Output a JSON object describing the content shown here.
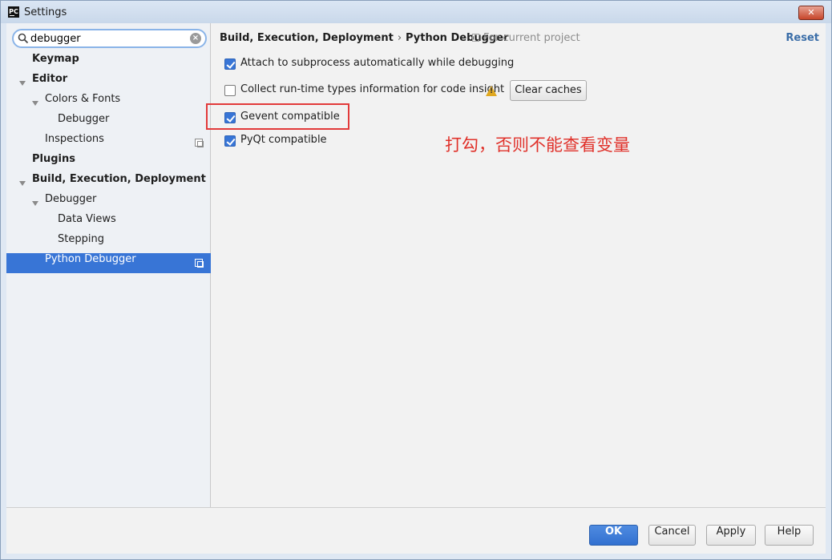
{
  "window": {
    "title": "Settings",
    "app_icon": "PC",
    "close_glyph": "✕"
  },
  "search": {
    "value": "debugger",
    "placeholder": ""
  },
  "tree": [
    {
      "label": "Keymap",
      "bold": true,
      "level": 0,
      "expandable": false,
      "project_icon": false,
      "selected": false
    },
    {
      "label": "Editor",
      "bold": true,
      "level": 0,
      "expandable": true,
      "project_icon": false,
      "selected": false
    },
    {
      "label": "Colors & Fonts",
      "bold": false,
      "level": 1,
      "expandable": true,
      "project_icon": false,
      "selected": false
    },
    {
      "label": "Debugger",
      "bold": false,
      "level": 2,
      "expandable": false,
      "project_icon": false,
      "selected": false
    },
    {
      "label": "Inspections",
      "bold": false,
      "level": 1,
      "expandable": false,
      "project_icon": true,
      "selected": false
    },
    {
      "label": "Plugins",
      "bold": true,
      "level": 0,
      "expandable": false,
      "project_icon": false,
      "selected": false
    },
    {
      "label": "Build, Execution, Deployment",
      "bold": true,
      "level": 0,
      "expandable": true,
      "project_icon": false,
      "selected": false
    },
    {
      "label": "Debugger",
      "bold": false,
      "level": 1,
      "expandable": true,
      "project_icon": false,
      "selected": false
    },
    {
      "label": "Data Views",
      "bold": false,
      "level": 2,
      "expandable": false,
      "project_icon": false,
      "selected": false
    },
    {
      "label": "Stepping",
      "bold": false,
      "level": 2,
      "expandable": false,
      "project_icon": false,
      "selected": false
    },
    {
      "label": "Python Debugger",
      "bold": false,
      "level": 1,
      "expandable": false,
      "project_icon": true,
      "selected": true
    }
  ],
  "header": {
    "breadcrumb_parent": "Build, Execution, Deployment",
    "breadcrumb_separator": "›",
    "breadcrumb_current": "Python Debugger",
    "scope": "For current project",
    "reset": "Reset"
  },
  "options": {
    "attach_subprocess": {
      "label": "Attach to subprocess automatically while debugging",
      "checked": true
    },
    "collect_types": {
      "label": "Collect run-time types information for code insight",
      "checked": false
    },
    "gevent": {
      "label": "Gevent compatible",
      "checked": true
    },
    "pyqt": {
      "label": "PyQt compatible",
      "checked": true
    }
  },
  "clear_caches": "Clear caches",
  "annotation": "打勾，否则不能查看变量",
  "buttons": {
    "ok": "OK",
    "cancel": "Cancel",
    "apply": "Apply",
    "help": "Help"
  },
  "colors": {
    "accent": "#3875d6",
    "annotation": "#e0312a",
    "link": "#3b6ea8"
  }
}
